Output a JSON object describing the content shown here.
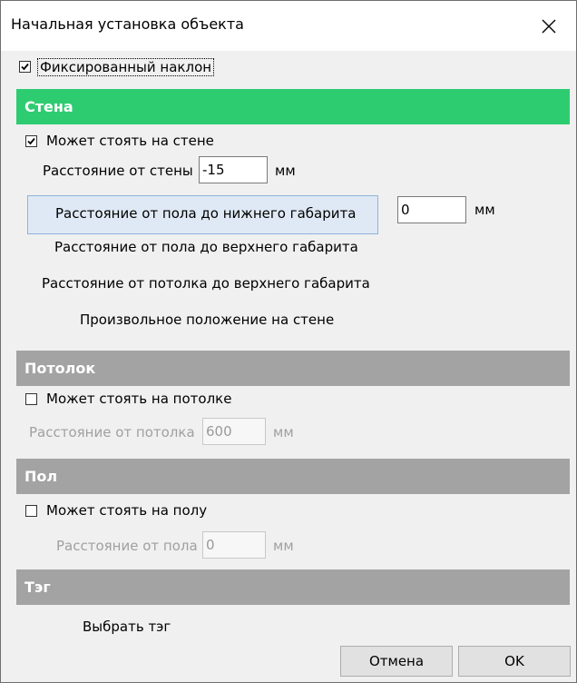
{
  "window": {
    "title": "Начальная установка объекта",
    "close_icon": "close-icon"
  },
  "fixed_tilt": {
    "label": "Фиксированный наклон",
    "checked": true
  },
  "wall": {
    "header": "Стена",
    "header_color": "#2ecc71",
    "can_stand": {
      "label": "Может стоять на стене",
      "checked": true
    },
    "distance_label": "Расстояние от стены",
    "distance_value": "-15",
    "distance_unit": "мм",
    "floor_to_bottom_label": "Расстояние от пола до нижнего габарита",
    "floor_to_bottom_value": "0",
    "floor_to_bottom_unit": "мм",
    "floor_to_top_label": "Расстояние от пола до верхнего габарита",
    "ceiling_to_top_label": "Расстояние от потолка до верхнего габарита",
    "arbitrary_label": "Произвольное положение на стене"
  },
  "ceiling": {
    "header": "Потолок",
    "can_stand": {
      "label": "Может стоять на потолке",
      "checked": false
    },
    "distance_label": "Расстояние от потолка",
    "distance_value": "600",
    "distance_unit": "мм"
  },
  "floor": {
    "header": "Пол",
    "can_stand": {
      "label": "Может стоять на полу",
      "checked": false
    },
    "distance_label": "Расстояние от пола",
    "distance_value": "0",
    "distance_unit": "мм"
  },
  "tag": {
    "header": "Тэг",
    "select_label": "Выбрать тэг"
  },
  "buttons": {
    "cancel": "Отмена",
    "ok": "OK"
  },
  "colors": {
    "section_gray": "#a3a3a3",
    "dialog_bg": "#f0f0f0"
  }
}
